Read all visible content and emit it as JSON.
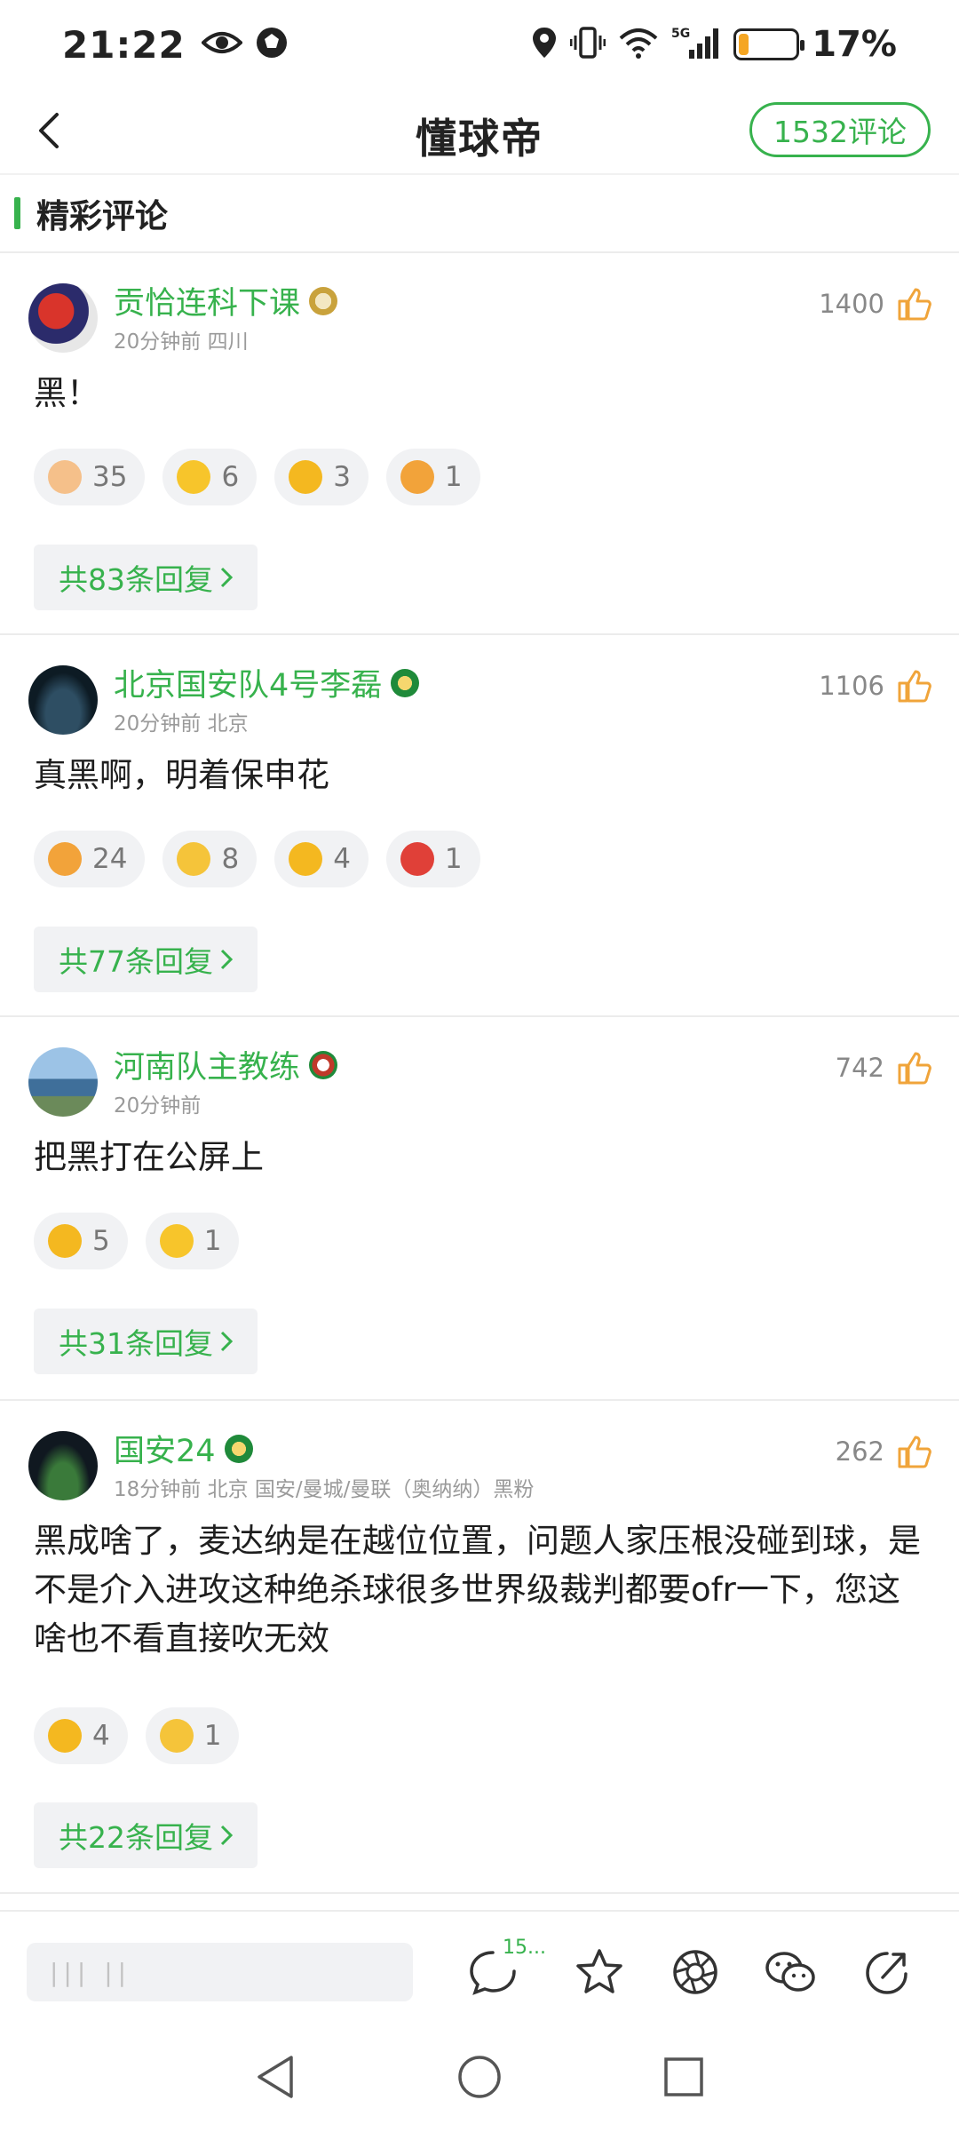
{
  "status_bar": {
    "time": "21:22",
    "battery_percent": 17,
    "battery_text": "17%",
    "network": "5G"
  },
  "nav": {
    "title": "懂球帝",
    "comment_count_label": "1532评论"
  },
  "section": {
    "title": "精彩评论"
  },
  "comments": [
    {
      "username": "贡恰连科下课",
      "meta": "20分钟前 四川",
      "likes": "1400",
      "text": "黑！",
      "reactions": [
        {
          "icon": "thumbs-up-emoji",
          "count": "35"
        },
        {
          "icon": "laughing-emoji",
          "count": "6"
        },
        {
          "icon": "angry-emoji",
          "count": "3"
        },
        {
          "icon": "tiger-emoji",
          "count": "1"
        }
      ],
      "replies": "共83条回复"
    },
    {
      "username": "北京国安队4号李磊",
      "meta": "20分钟前 北京",
      "likes": "1106",
      "text": "真黑啊，明着保申花",
      "reactions": [
        {
          "icon": "tiger-emoji",
          "count": "24"
        },
        {
          "icon": "thinking-emoji",
          "count": "8"
        },
        {
          "icon": "angry-emoji",
          "count": "4"
        },
        {
          "icon": "mascot-emoji",
          "count": "1"
        }
      ],
      "replies": "共77条回复"
    },
    {
      "username": "河南队主教练",
      "meta": "20分钟前",
      "likes": "742",
      "text": "把黑打在公屏上",
      "reactions": [
        {
          "icon": "angry-emoji",
          "count": "5"
        },
        {
          "icon": "laughing-emoji",
          "count": "1"
        }
      ],
      "replies": "共31条回复"
    },
    {
      "username": "国安24",
      "meta": "18分钟前 北京 国安/曼城/曼联（奥纳纳）黑粉",
      "likes": "262",
      "text": "黑成啥了，麦达纳是在越位位置，问题人家压根没碰到球，是不是介入进攻这种绝杀球很多世界级裁判都要ofr一下，您这啥也不看直接吹无效",
      "reactions": [
        {
          "icon": "angry-emoji",
          "count": "4"
        },
        {
          "icon": "shrug-emoji",
          "count": "1"
        }
      ],
      "replies": "共22条回复"
    }
  ],
  "bottom_bar": {
    "input_placeholder": "||| ||",
    "comment_badge": "15..."
  },
  "colors": {
    "accent": "#37b24d",
    "like": "#f0a43a"
  }
}
